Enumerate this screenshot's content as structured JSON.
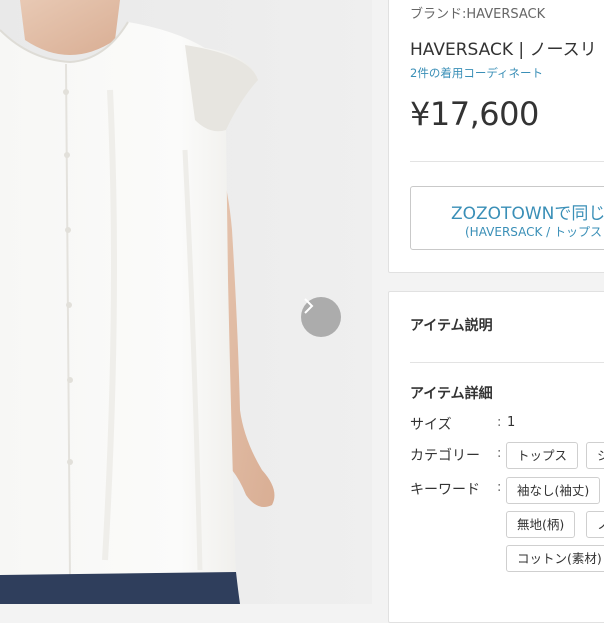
{
  "product": {
    "brand_line": "ブランド:HAVERSACK",
    "title": "HAVERSACK | ノースリ",
    "coordinate_link": "2件の着用コーディネート",
    "price": "¥17,600"
  },
  "zozo_button": {
    "main": "ZOZOTOWNで同じ",
    "sub": "(HAVERSACK / トップス"
  },
  "description": {
    "section_title": "アイテム説明",
    "details_title": "アイテム詳細",
    "size_label": "サイズ",
    "size_value": "1",
    "category_label": "カテゴリー",
    "keyword_label": "キーワード",
    "colon": ":",
    "category_tags": [
      "トップス",
      "シ"
    ],
    "keyword_tags": [
      "袖なし(袖丈)",
      "",
      "無地(柄)",
      "ノ",
      "コットン(素材)"
    ]
  },
  "colors": {
    "link": "#3a8fb7",
    "card_border": "#e1e1e1",
    "background": "#f3f3f3"
  },
  "icons": {
    "next": "chevron-right-icon"
  }
}
